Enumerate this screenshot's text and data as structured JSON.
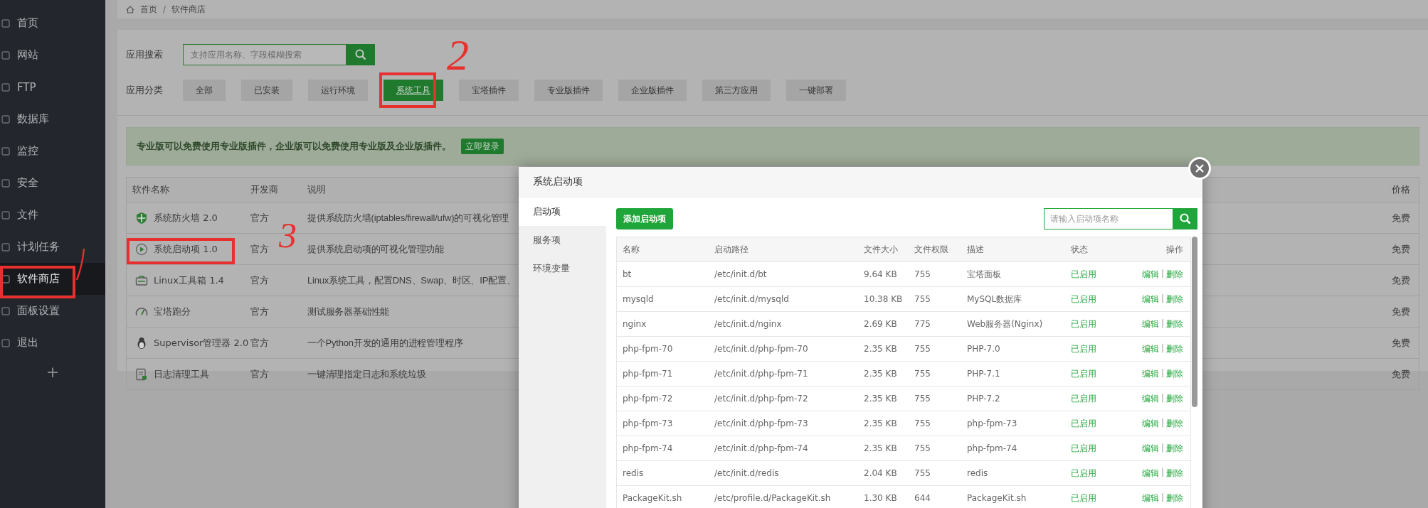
{
  "breadcrumb": [
    "首页",
    "/",
    "软件商店"
  ],
  "sidebar": {
    "items": [
      {
        "label": "首页",
        "selected": false
      },
      {
        "label": "网站",
        "selected": false
      },
      {
        "label": "FTP",
        "selected": false
      },
      {
        "label": "数据库",
        "selected": false
      },
      {
        "label": "监控",
        "selected": false
      },
      {
        "label": "安全",
        "selected": false
      },
      {
        "label": "文件",
        "selected": false
      },
      {
        "label": "计划任务",
        "selected": false
      },
      {
        "label": "软件商店",
        "selected": true
      },
      {
        "label": "面板设置",
        "selected": false
      },
      {
        "label": "退出",
        "selected": false
      }
    ],
    "add": "+"
  },
  "search": {
    "label": "应用搜索",
    "placeholder": "支持应用名称、字段模糊搜索"
  },
  "categories": {
    "label": "应用分类",
    "items": [
      {
        "label": "全部",
        "selected": false
      },
      {
        "label": "已安装",
        "selected": false
      },
      {
        "label": "运行环境",
        "selected": false
      },
      {
        "label": "系统工具",
        "selected": true
      },
      {
        "label": "宝塔插件",
        "selected": false
      },
      {
        "label": "专业版插件",
        "selected": false
      },
      {
        "label": "企业版插件",
        "selected": false
      },
      {
        "label": "第三方应用",
        "selected": false
      },
      {
        "label": "一键部署",
        "selected": false
      }
    ]
  },
  "banner": {
    "text": "专业版可以免费使用专业版插件，企业版可以免费使用专业版及企业版插件。",
    "button": "立即登录"
  },
  "table": {
    "columns": [
      "软件名称",
      "开发商",
      "说明",
      "价格"
    ],
    "rows": [
      {
        "name": "系统防火墙 2.0",
        "developer": "官方",
        "description": "提供系统防火墙(iptables/firewall/ufw)的可视化管理",
        "price": "免费"
      },
      {
        "name": "系统启动项 1.0",
        "developer": "官方",
        "description": "提供系统启动项的可视化管理功能",
        "price": "免费"
      },
      {
        "name": "Linux工具箱 1.4",
        "developer": "官方",
        "description": "Linux系统工具，配置DNS、Swap、时区、IP配置、",
        "price": "免费"
      },
      {
        "name": "宝塔跑分",
        "developer": "官方",
        "description": "测试服务器基础性能",
        "price": "免费"
      },
      {
        "name": "Supervisor管理器 2.0",
        "developer": "官方",
        "description": "一个Python开发的通用的进程管理程序",
        "price": "免费"
      },
      {
        "name": "日志清理工具",
        "developer": "官方",
        "description": "一键清理指定日志和系统垃圾",
        "price": "免费"
      }
    ]
  },
  "modal": {
    "title": "系统启动项",
    "tabs": [
      {
        "label": "启动项",
        "selected": true
      },
      {
        "label": "服务项",
        "selected": false
      },
      {
        "label": "环境变量",
        "selected": false
      }
    ],
    "add_button": "添加启动项",
    "search": {
      "placeholder": "请输入启动项名称"
    },
    "table": {
      "columns": [
        "名称",
        "启动路径",
        "文件大小",
        "文件权限",
        "描述",
        "状态",
        "操作"
      ],
      "rows": [
        {
          "name": "bt",
          "path": "/etc/init.d/bt",
          "size": "9.64 KB",
          "permission": "755",
          "description": "宝塔面板",
          "status": "已启用",
          "enabled": true,
          "actions": [
            "编辑",
            "|",
            "删除"
          ]
        },
        {
          "name": "mysqld",
          "path": "/etc/init.d/mysqld",
          "size": "10.38 KB",
          "permission": "755",
          "description": "MySQL数据库",
          "status": "已启用",
          "enabled": true,
          "actions": [
            "编辑",
            "|",
            "删除"
          ]
        },
        {
          "name": "nginx",
          "path": "/etc/init.d/nginx",
          "size": "2.69 KB",
          "permission": "775",
          "description": "Web服务器(Nginx)",
          "status": "已启用",
          "enabled": true,
          "actions": [
            "编辑",
            "|",
            "删除"
          ]
        },
        {
          "name": "php-fpm-70",
          "path": "/etc/init.d/php-fpm-70",
          "size": "2.35 KB",
          "permission": "755",
          "description": "PHP-7.0",
          "status": "已启用",
          "enabled": true,
          "actions": [
            "编辑",
            "|",
            "删除"
          ]
        },
        {
          "name": "php-fpm-71",
          "path": "/etc/init.d/php-fpm-71",
          "size": "2.35 KB",
          "permission": "755",
          "description": "PHP-7.1",
          "status": "已启用",
          "enabled": true,
          "actions": [
            "编辑",
            "|",
            "删除"
          ]
        },
        {
          "name": "php-fpm-72",
          "path": "/etc/init.d/php-fpm-72",
          "size": "2.35 KB",
          "permission": "755",
          "description": "PHP-7.2",
          "status": "已启用",
          "enabled": true,
          "actions": [
            "编辑",
            "|",
            "删除"
          ]
        },
        {
          "name": "php-fpm-73",
          "path": "/etc/init.d/php-fpm-73",
          "size": "2.35 KB",
          "permission": "755",
          "description": "php-fpm-73",
          "status": "已启用",
          "enabled": true,
          "actions": [
            "编辑",
            "|",
            "删除"
          ]
        },
        {
          "name": "php-fpm-74",
          "path": "/etc/init.d/php-fpm-74",
          "size": "2.35 KB",
          "permission": "755",
          "description": "php-fpm-74",
          "status": "已启用",
          "enabled": true,
          "actions": [
            "编辑",
            "|",
            "删除"
          ]
        },
        {
          "name": "redis",
          "path": "/etc/init.d/redis",
          "size": "2.04 KB",
          "permission": "755",
          "description": "redis",
          "status": "已启用",
          "enabled": true,
          "actions": [
            "编辑",
            "|",
            "删除"
          ]
        },
        {
          "name": "PackageKit.sh",
          "path": "/etc/profile.d/PackageKit.sh",
          "size": "1.30 KB",
          "permission": "644",
          "description": "PackageKit.sh",
          "status": "已启用",
          "enabled": true,
          "actions": [
            "编辑",
            "|",
            "删除"
          ]
        }
      ]
    }
  },
  "annotations": [
    "2",
    "3"
  ]
}
